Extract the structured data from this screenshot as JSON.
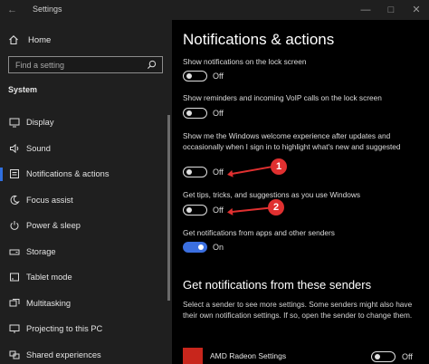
{
  "window": {
    "title": "Settings"
  },
  "sidebar": {
    "home_label": "Home",
    "search_placeholder": "Find a setting",
    "section_label": "System",
    "items": [
      {
        "label": "Display",
        "icon": "monitor-icon"
      },
      {
        "label": "Sound",
        "icon": "speaker-icon"
      },
      {
        "label": "Notifications & actions",
        "icon": "notifications-icon",
        "active": true
      },
      {
        "label": "Focus assist",
        "icon": "moon-icon"
      },
      {
        "label": "Power & sleep",
        "icon": "power-icon"
      },
      {
        "label": "Storage",
        "icon": "drive-icon"
      },
      {
        "label": "Tablet mode",
        "icon": "tablet-icon"
      },
      {
        "label": "Multitasking",
        "icon": "multitasking-icon"
      },
      {
        "label": "Projecting to this PC",
        "icon": "projecting-icon"
      },
      {
        "label": "Shared experiences",
        "icon": "shared-experiences-icon"
      }
    ]
  },
  "main": {
    "title": "Notifications & actions",
    "settings": [
      {
        "label": "Show notifications on the lock screen",
        "state": "Off"
      },
      {
        "label": "Show reminders and incoming VoIP calls on the lock screen",
        "state": "Off"
      },
      {
        "label": "Show me the Windows welcome experience after updates and occasionally when I sign in to highlight what's new and suggested",
        "state": "Off"
      },
      {
        "label": "Get tips, tricks, and suggestions as you use Windows",
        "state": "Off"
      },
      {
        "label": "Get notifications from apps and other senders",
        "state": "On"
      }
    ],
    "senders_title": "Get notifications from these senders",
    "senders_desc": "Select a sender to see more settings. Some senders might also have their own notification settings. If so, open the sender to change them.",
    "sender": {
      "name": "AMD Radeon Settings",
      "state": "Off"
    }
  },
  "callouts": [
    "1",
    "2"
  ],
  "colors": {
    "accent": "#3b6fe0",
    "callout": "#e03030",
    "sidebar_bg": "#1f1f1f"
  }
}
